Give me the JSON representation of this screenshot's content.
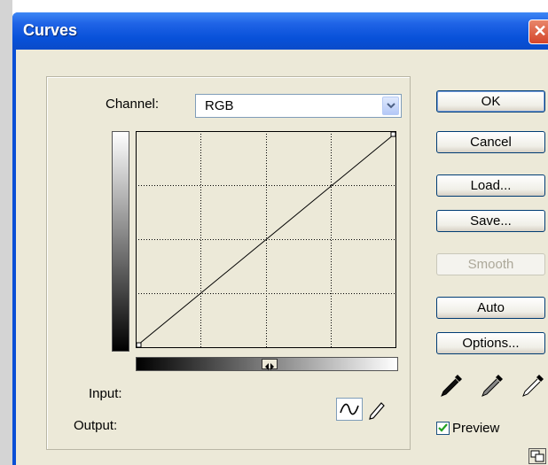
{
  "window": {
    "title": "Curves",
    "close_glyph": "✕"
  },
  "channel": {
    "label": "Channel:",
    "value": "RGB"
  },
  "readouts": {
    "input_label": "Input:",
    "output_label": "Output:"
  },
  "buttons": {
    "ok": "OK",
    "cancel": "Cancel",
    "load": "Load...",
    "save": "Save...",
    "smooth": "Smooth",
    "auto": "Auto",
    "options": "Options..."
  },
  "preview": {
    "label": "Preview",
    "checked": true
  },
  "icons": {
    "curve_tool": "curve-tool-icon",
    "pencil_tool": "pencil-tool-icon",
    "black_eyedropper": "black-eyedropper-icon",
    "gray_eyedropper": "gray-eyedropper-icon",
    "white_eyedropper": "white-eyedropper-icon",
    "expand": "expand-icon"
  },
  "colors": {
    "title_bar": "#0a4fd6",
    "dialog_bg": "#ece9d8",
    "close_button": "#d4452a"
  }
}
